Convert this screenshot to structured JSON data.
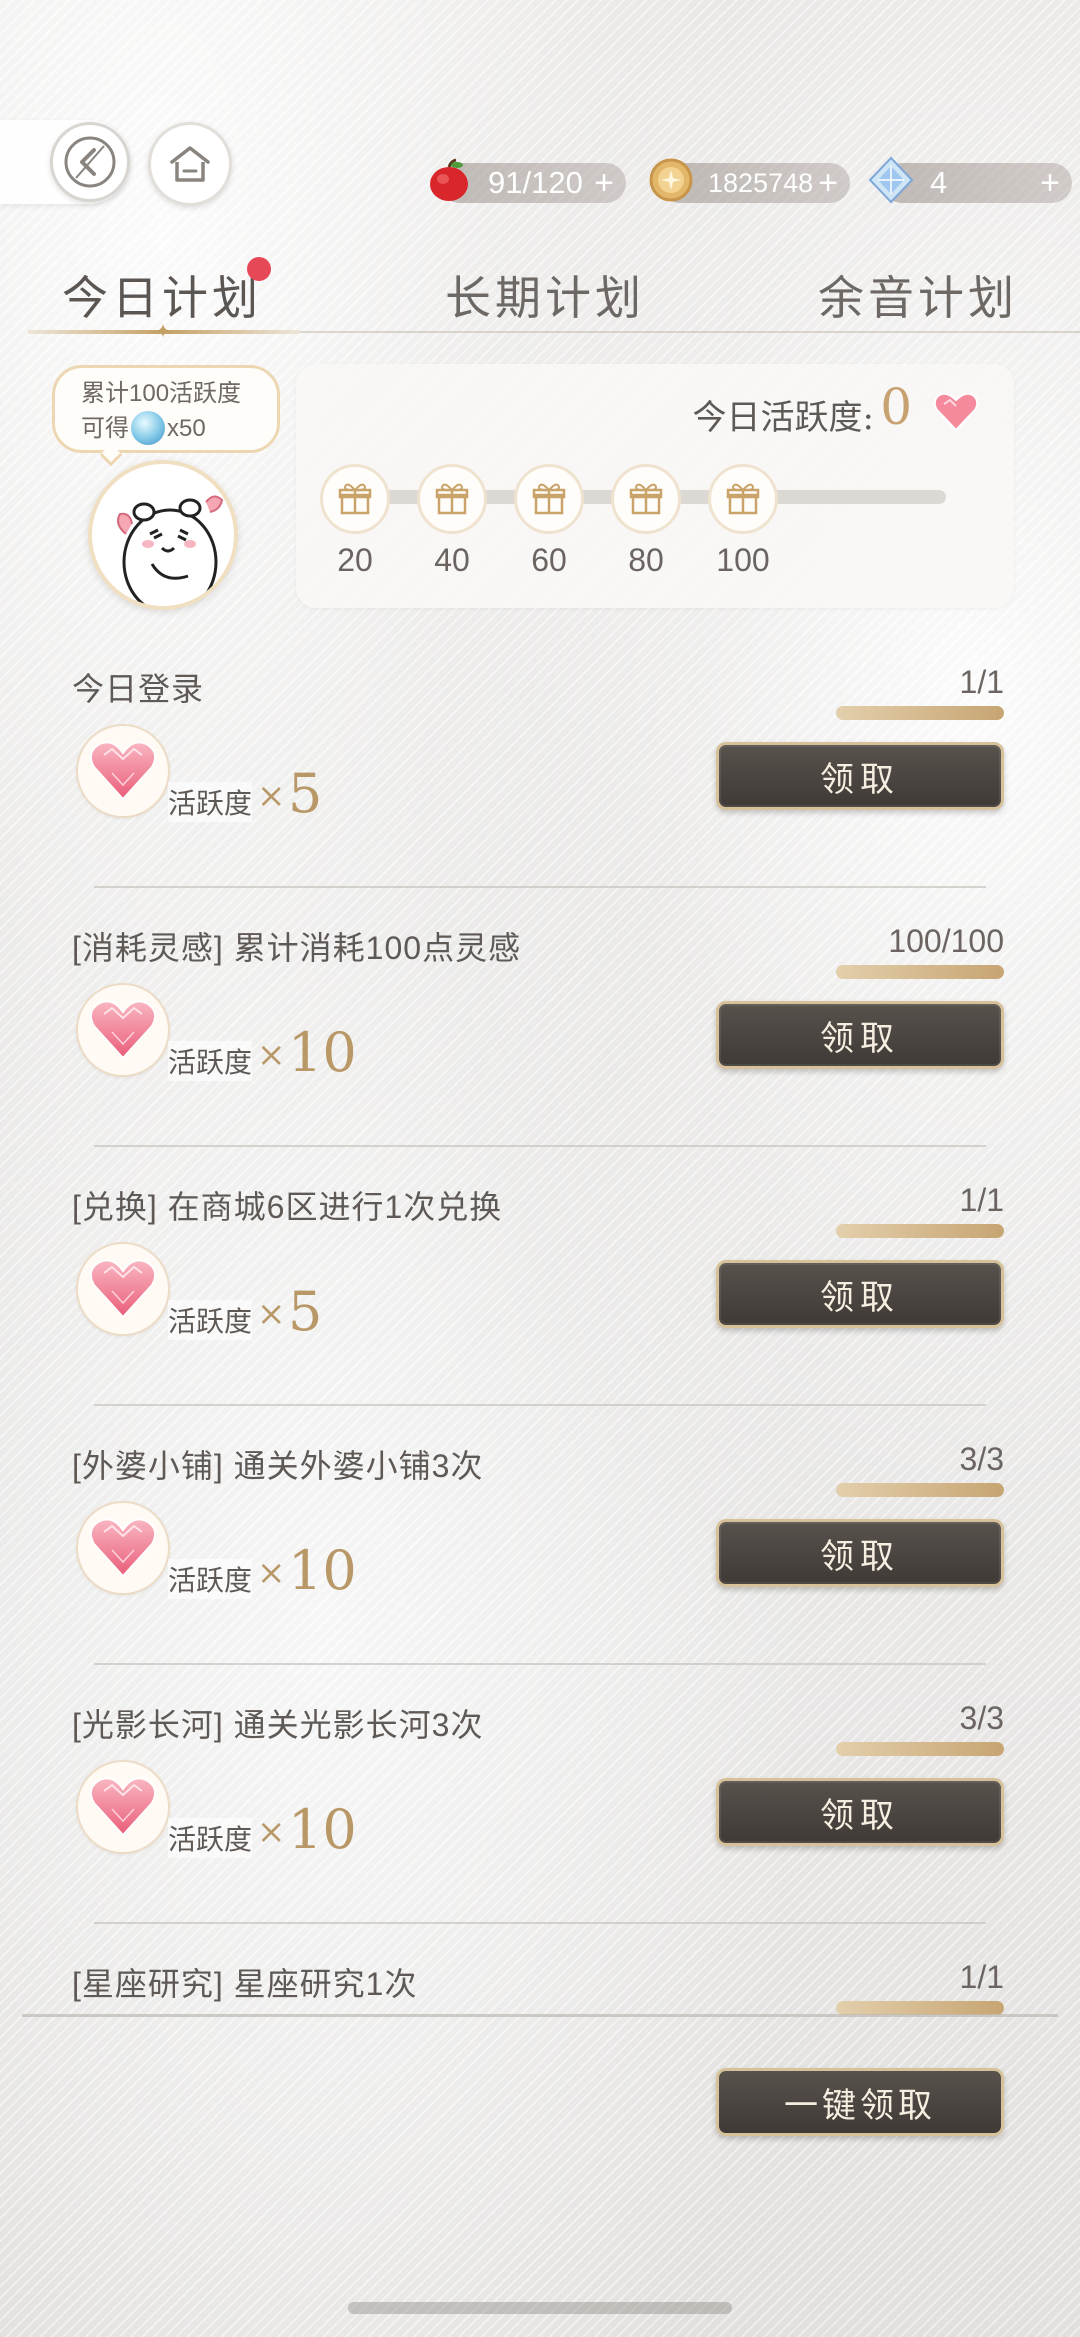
{
  "resources": {
    "energy": "91/120",
    "gold": "1825748",
    "crystal": "4",
    "plus": "+"
  },
  "tabs": [
    {
      "label": "今日计划",
      "active": true
    },
    {
      "label": "长期计划",
      "active": false
    },
    {
      "label": "余音计划",
      "active": false
    }
  ],
  "bubble": {
    "line1": "累计100活跃度",
    "line2_prefix": "可得",
    "line2_suffix": "x50"
  },
  "activity": {
    "label": "今日活跃度:",
    "value": "0",
    "milestones": [
      "20",
      "40",
      "60",
      "80",
      "100"
    ]
  },
  "reward_label": "活跃度",
  "times_sign": "×",
  "tasks": [
    {
      "title": "今日登录",
      "progress": "1/1",
      "fill": 1.0,
      "reward": "5",
      "button": "领取"
    },
    {
      "title": "[消耗灵感] 累计消耗100点灵感",
      "progress": "100/100",
      "fill": 1.0,
      "reward": "10",
      "button": "领取"
    },
    {
      "title": "[兑换] 在商城6区进行1次兑换",
      "progress": "1/1",
      "fill": 1.0,
      "reward": "5",
      "button": "领取"
    },
    {
      "title": "[外婆小铺] 通关外婆小铺3次",
      "progress": "3/3",
      "fill": 1.0,
      "reward": "10",
      "button": "领取"
    },
    {
      "title": "[光影长河] 通关光影长河3次",
      "progress": "3/3",
      "fill": 1.0,
      "reward": "10",
      "button": "领取"
    },
    {
      "title": "[星座研究] 星座研究1次",
      "progress": "1/1",
      "fill": 1.0
    }
  ],
  "claim_all": "一键领取",
  "colors": {
    "accent_gold": "#c7a172",
    "button_dark": "#4a4541",
    "red_dot": "#e74857"
  }
}
